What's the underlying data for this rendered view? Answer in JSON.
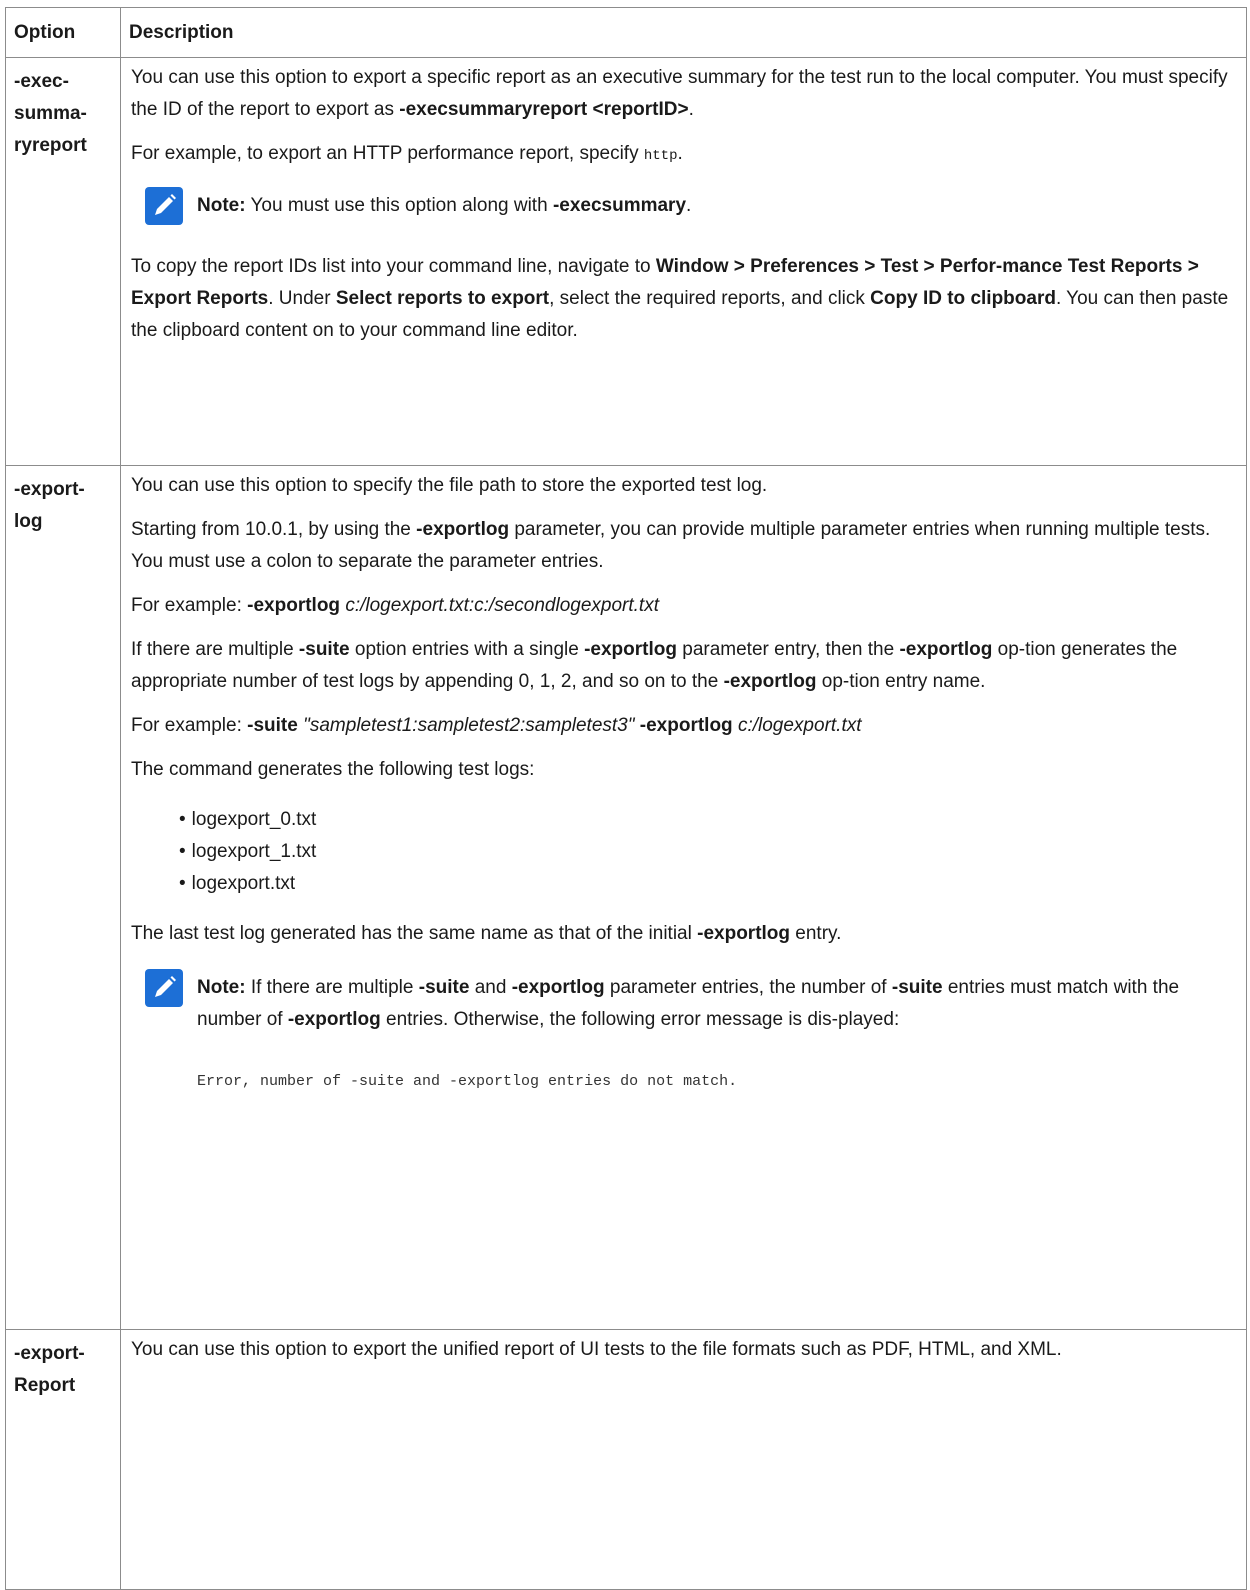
{
  "header": {
    "option": "Option",
    "description": "Description"
  },
  "rows": {
    "execsummaryreport": {
      "name_l1": "-exec-",
      "name_l2": "summa-",
      "name_l3": "ryreport",
      "p1_a": "You can use this option to export a specific report as an executive summary for the test run to the local computer. You must specify the ID of the report to export as ",
      "p1_b": "-execsummaryreport <reportID>",
      "p1_c": ".",
      "p2_a": "For example, to export an HTTP performance report, specify ",
      "p2_code": "http",
      "p2_c": ".",
      "note_label": "Note:",
      "note_a": " You must use this option along with ",
      "note_b": "-execsummary",
      "note_c": ".",
      "p3_a": "To copy the report IDs list into your command line, navigate to ",
      "p3_b": "Window > Preferences > Test > Perfor-mance Test Reports > Export Reports",
      "p3_c": ". Under ",
      "p3_d": "Select reports to export",
      "p3_e": ", select the required reports, and click ",
      "p3_f": "Copy ID to clipboard",
      "p3_g": ". You can then paste the clipboard content on to your command line editor."
    },
    "exportlog": {
      "name_l1": "-export-",
      "name_l2": "log",
      "p1": "You can use this option to specify the file path to store the exported test log.",
      "p2_a": "Starting from 10.0.1, by using the ",
      "p2_b": "-exportlog",
      "p2_c": " parameter, you can provide multiple parameter entries when running multiple tests. You must use a colon to separate the parameter entries.",
      "p3_a": "For example: ",
      "p3_b": "-exportlog",
      "p3_c": "c:/logexport.txt:c:/secondlogexport.txt",
      "p4_a": "If there are multiple ",
      "p4_b": "-suite",
      "p4_c": " option entries with a single ",
      "p4_d": "-exportlog",
      "p4_e": " parameter entry, then the ",
      "p4_f": "-exportlog",
      "p4_g": " op-tion generates the appropriate number of test logs by appending 0, 1, 2, and so on to the ",
      "p4_h": "-exportlog",
      "p4_i": " op-tion entry name.",
      "p5_a": "For example: ",
      "p5_b": "-suite",
      "p5_c": "\"sampletest1:sampletest2:sampletest3\"",
      "p5_d": "-exportlog",
      "p5_e": "c:/logexport.txt",
      "p6": "The command generates the following test logs:",
      "logs": [
        "logexport_0.txt",
        "logexport_1.txt",
        "logexport.txt"
      ],
      "p7_a": "The last test log generated has the same name as that of the initial ",
      "p7_b": "-exportlog",
      "p7_c": " entry.",
      "note_label": "Note:",
      "note_a": " If there are multiple ",
      "note_b": "-suite",
      "note_c": " and ",
      "note_d": "-exportlog",
      "note_e": " parameter entries, the number of ",
      "note_f": "-suite",
      "note_g": " entries must match with the number of ",
      "note_h": "-exportlog",
      "note_i": " entries. Otherwise, the following error message is dis-played:",
      "error_code": "Error, number of -suite and -exportlog entries do not match."
    },
    "exportreport": {
      "name_l1": "-export-",
      "name_l2": "Report",
      "p1": "You can use this option to export the unified report of UI tests to the file formats such as PDF, HTML, and XML."
    }
  },
  "colors": {
    "note_icon": "#1d6fd6",
    "border": "#8c8c8c"
  },
  "icons": {
    "note": "pencil-note-icon"
  }
}
